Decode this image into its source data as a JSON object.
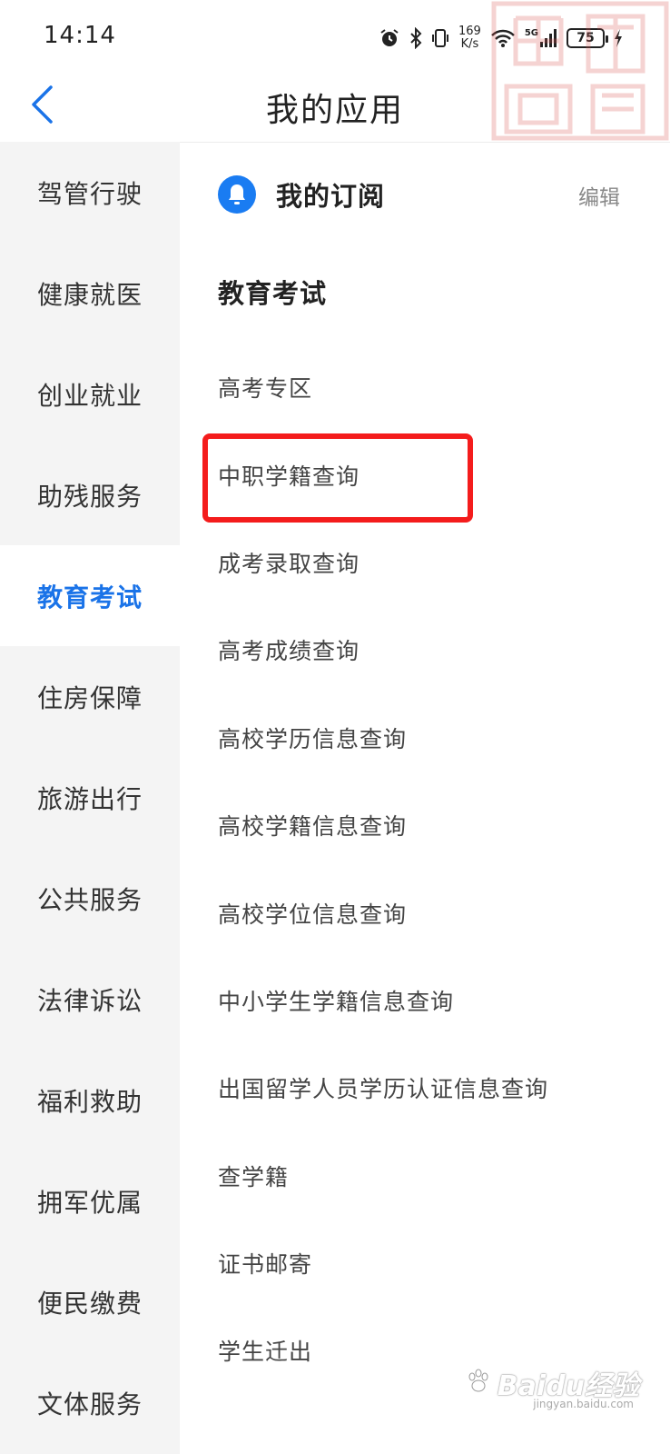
{
  "status_bar": {
    "time": "14:14",
    "net_speed_value": "169",
    "net_speed_unit": "K/s",
    "network_type": "5G",
    "battery": "75",
    "icons": [
      "alarm-icon",
      "bluetooth-icon",
      "vibrate-icon",
      "wifi-icon",
      "signal-icon",
      "battery-icon",
      "charging-icon"
    ]
  },
  "header": {
    "title": "我的应用",
    "back_icon": "chevron-left-icon"
  },
  "sidebar": {
    "active_index": 4,
    "items": [
      {
        "label": "驾管行驶"
      },
      {
        "label": "健康就医"
      },
      {
        "label": "创业就业"
      },
      {
        "label": "助残服务"
      },
      {
        "label": "教育考试"
      },
      {
        "label": "住房保障"
      },
      {
        "label": "旅游出行"
      },
      {
        "label": "公共服务"
      },
      {
        "label": "法律诉讼"
      },
      {
        "label": "福利救助"
      },
      {
        "label": "拥军优属"
      },
      {
        "label": "便民缴费"
      },
      {
        "label": "文体服务"
      }
    ]
  },
  "main": {
    "subscriptions": {
      "title": "我的订阅",
      "edit_label": "编辑",
      "icon": "bell-icon"
    },
    "section_title": "教育考试",
    "apps": [
      {
        "label": "高考专区"
      },
      {
        "label": "中职学籍查询"
      },
      {
        "label": "成考录取查询"
      },
      {
        "label": "高考成绩查询"
      },
      {
        "label": "高校学历信息查询"
      },
      {
        "label": "高校学籍信息查询"
      },
      {
        "label": "高校学位信息查询"
      },
      {
        "label": "中小学生学籍信息查询"
      },
      {
        "label": "出国留学人员学历认证信息查询"
      },
      {
        "label": "查学籍"
      },
      {
        "label": "证书邮寄"
      },
      {
        "label": "学生迁出"
      }
    ],
    "highlighted_app": "中职学籍查询"
  },
  "watermark": {
    "brand": "Baidu经验",
    "url": "jingyan.baidu.com"
  },
  "colors": {
    "accent": "#1a73e8",
    "bell": "#1a7cf2",
    "highlight": "#f41c1c",
    "sidebar_bg": "#f4f4f4"
  }
}
